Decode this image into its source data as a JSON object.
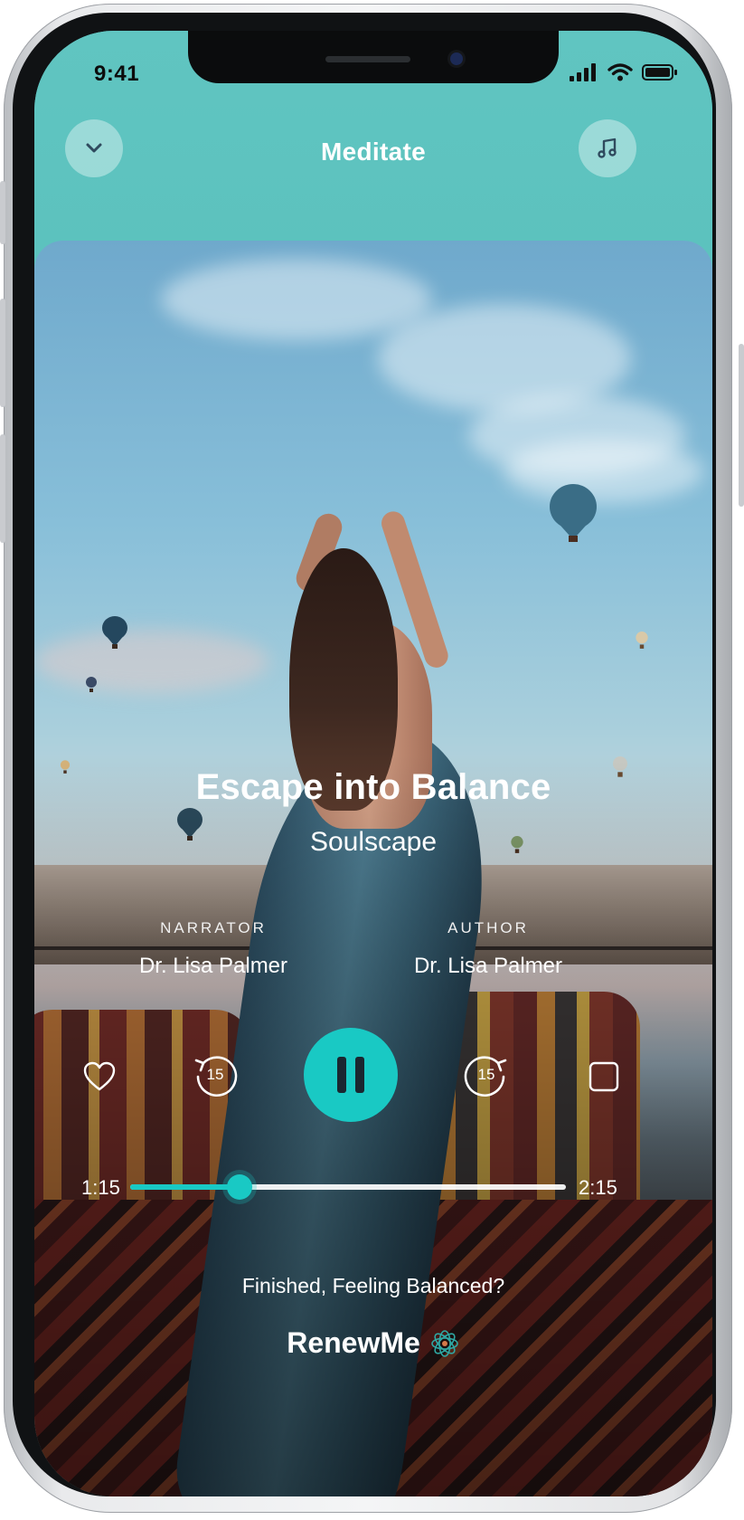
{
  "status_bar": {
    "time": "9:41"
  },
  "header": {
    "title": "Meditate"
  },
  "track": {
    "title": "Escape into Balance",
    "collection": "Soulscape"
  },
  "credits": {
    "narrator_label": "NARRATOR",
    "narrator_name": "Dr. Lisa Palmer",
    "author_label": "AUTHOR",
    "author_name": "Dr. Lisa Palmer"
  },
  "controls": {
    "rewind_seconds": "15",
    "forward_seconds": "15",
    "state": "playing"
  },
  "progress": {
    "elapsed": "1:15",
    "total": "2:15",
    "fraction": 0.25
  },
  "footer": {
    "prompt": "Finished, Feeling Balanced?",
    "brand": "RenewMe"
  },
  "colors": {
    "accent": "#19c9c4",
    "header_bg": "#5fc4c1"
  },
  "icons": [
    "chevron-down-icon",
    "music-icon",
    "heart-icon",
    "rewind-15-icon",
    "pause-icon",
    "forward-15-icon",
    "square-icon",
    "lotus-logo-icon"
  ]
}
